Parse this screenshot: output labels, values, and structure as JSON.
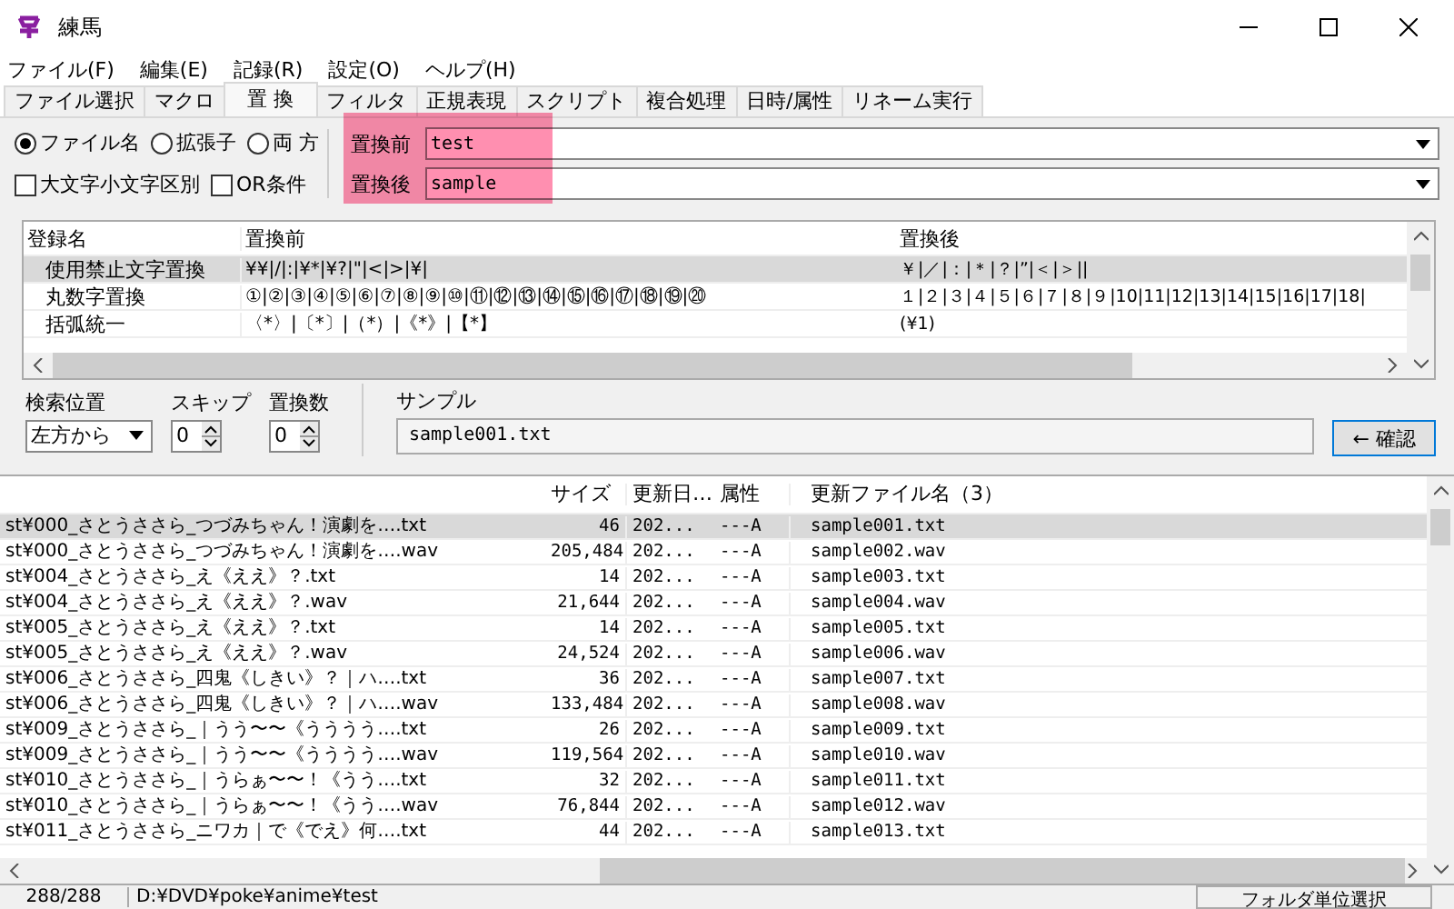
{
  "window": {
    "title": "練馬"
  },
  "menu": [
    "ファイル(F)",
    "編集(E)",
    "記録(R)",
    "設定(O)",
    "ヘルプ(H)"
  ],
  "tabs": [
    {
      "label": "ファイル選択",
      "selected": false
    },
    {
      "label": "マクロ",
      "selected": false
    },
    {
      "label": "置 換",
      "selected": true
    },
    {
      "label": "フィルタ",
      "selected": false
    },
    {
      "label": "正規表現",
      "selected": false
    },
    {
      "label": "スクリプト",
      "selected": false
    },
    {
      "label": "複合処理",
      "selected": false
    },
    {
      "label": "日時/属性",
      "selected": false
    },
    {
      "label": "リネーム実行",
      "selected": false
    }
  ],
  "target": [
    {
      "label": "ファイル名",
      "selected": true
    },
    {
      "label": "拡張子",
      "selected": false
    },
    {
      "label": "両 方",
      "selected": false
    }
  ],
  "options": [
    {
      "label": "大文字小文字区別",
      "checked": false
    },
    {
      "label": "OR条件",
      "checked": false
    }
  ],
  "replace_fields": [
    {
      "label": "置換前",
      "value": "test"
    },
    {
      "label": "置換後",
      "value": "sample"
    }
  ],
  "rules": {
    "columns": [
      "登録名",
      "置換前",
      "置換後"
    ],
    "rows": [
      {
        "name": "使用禁止文字置換",
        "before": "¥¥|/|:|¥*|¥?|\"|<|>|¥|",
        "after": "￥|／|：|＊|？|”|＜|＞||",
        "selected": true
      },
      {
        "name": "丸数字置換",
        "before": "①|②|③|④|⑤|⑥|⑦|⑧|⑨|⑩|⑪|⑫|⑬|⑭|⑮|⑯|⑰|⑱|⑲|⑳",
        "after": "１|２|３|４|５|６|７|８|９|10|11|12|13|14|15|16|17|18|",
        "selected": false
      },
      {
        "name": "括弧統一",
        "before": "〈*〉|〔*〕|（*）|《*》|【*】",
        "after": "(¥1)",
        "selected": false
      }
    ]
  },
  "search_position": {
    "label": "検索位置",
    "value": "左方から"
  },
  "skip": {
    "label": "スキップ",
    "value": "0"
  },
  "count": {
    "label": "置換数",
    "value": "0"
  },
  "sample": {
    "label": "サンプル",
    "value": "sample001.txt"
  },
  "confirm_button": "← 確認",
  "files": {
    "columns": [
      "サイズ",
      "更新日…",
      "属性",
      "更新ファイル名（3）"
    ],
    "rows": [
      {
        "name": "st¥000_さとうささら_つづみちゃん！演劇を….txt",
        "size": "46",
        "date": "202...",
        "attr": "---A",
        "new_name": "sample001.txt",
        "selected": true
      },
      {
        "name": "st¥000_さとうささら_つづみちゃん！演劇を….wav",
        "size": "205,484",
        "date": "202...",
        "attr": "---A",
        "new_name": "sample002.wav",
        "selected": false
      },
      {
        "name": "st¥004_さとうささら_え《ええ》？.txt",
        "size": "14",
        "date": "202...",
        "attr": "---A",
        "new_name": "sample003.txt",
        "selected": false
      },
      {
        "name": "st¥004_さとうささら_え《ええ》？.wav",
        "size": "21,644",
        "date": "202...",
        "attr": "---A",
        "new_name": "sample004.wav",
        "selected": false
      },
      {
        "name": "st¥005_さとうささら_え《ええ》？.txt",
        "size": "14",
        "date": "202...",
        "attr": "---A",
        "new_name": "sample005.txt",
        "selected": false
      },
      {
        "name": "st¥005_さとうささら_え《ええ》？.wav",
        "size": "24,524",
        "date": "202...",
        "attr": "---A",
        "new_name": "sample006.wav",
        "selected": false
      },
      {
        "name": "st¥006_さとうささら_四鬼《しきい》？｜ハ….txt",
        "size": "36",
        "date": "202...",
        "attr": "---A",
        "new_name": "sample007.txt",
        "selected": false
      },
      {
        "name": "st¥006_さとうささら_四鬼《しきい》？｜ハ….wav",
        "size": "133,484",
        "date": "202...",
        "attr": "---A",
        "new_name": "sample008.wav",
        "selected": false
      },
      {
        "name": "st¥009_さとうささら_｜うう〜〜《うううう….txt",
        "size": "26",
        "date": "202...",
        "attr": "---A",
        "new_name": "sample009.txt",
        "selected": false
      },
      {
        "name": "st¥009_さとうささら_｜うう〜〜《うううう….wav",
        "size": "119,564",
        "date": "202...",
        "attr": "---A",
        "new_name": "sample010.wav",
        "selected": false
      },
      {
        "name": "st¥010_さとうささら_｜うらぁ〜〜！《うう….txt",
        "size": "32",
        "date": "202...",
        "attr": "---A",
        "new_name": "sample011.txt",
        "selected": false
      },
      {
        "name": "st¥010_さとうささら_｜うらぁ〜〜！《うう….wav",
        "size": "76,844",
        "date": "202...",
        "attr": "---A",
        "new_name": "sample012.wav",
        "selected": false
      },
      {
        "name": "st¥011_さとうささら_ニワカ｜で《でえ》何….txt",
        "size": "44",
        "date": "202...",
        "attr": "---A",
        "new_name": "sample013.txt",
        "selected": false
      }
    ]
  },
  "status_bar": {
    "count": "288/288",
    "path": "D:¥DVD¥poke¥anime¥test",
    "button": "フォルダ単位選択"
  }
}
